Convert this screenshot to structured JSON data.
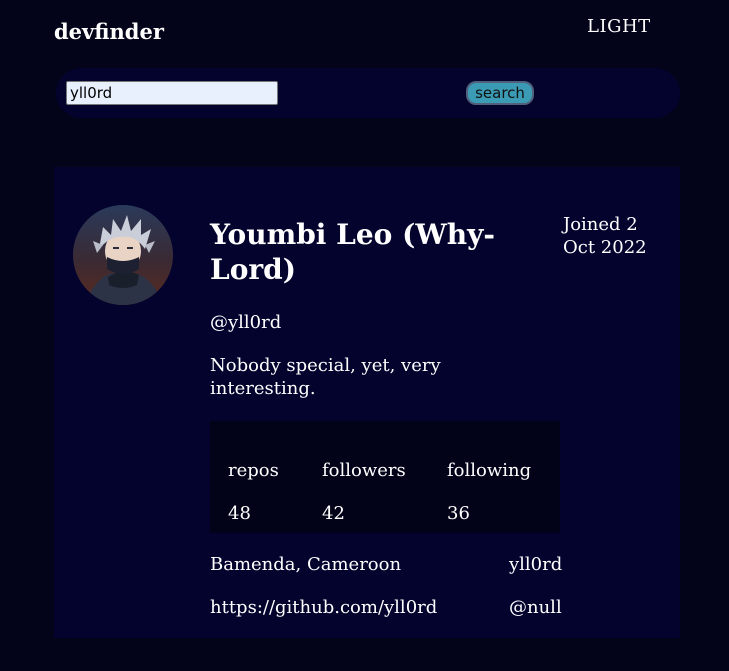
{
  "header": {
    "logo": "devfinder",
    "theme_toggle": "LIGHT"
  },
  "search": {
    "value": "yll0rd",
    "button_label": "search"
  },
  "profile": {
    "name": "Youmbi Leo (Why-Lord)",
    "joined": "Joined 2 Oct 2022",
    "handle": "@yll0rd",
    "bio": "Nobody special, yet, very interesting.",
    "stats": [
      {
        "label": "repos",
        "value": "48"
      },
      {
        "label": "followers",
        "value": "42"
      },
      {
        "label": "following",
        "value": "36"
      }
    ],
    "location": "Bamenda, Cameroon",
    "twitter": "yll0rd",
    "website": "https://github.com/yll0rd",
    "company": "@null"
  },
  "colors": {
    "background": "#03031a",
    "card": "#03032e",
    "stats_panel": "#020219",
    "search_button": "#3b9ab4",
    "input": "#e8f0fe"
  }
}
